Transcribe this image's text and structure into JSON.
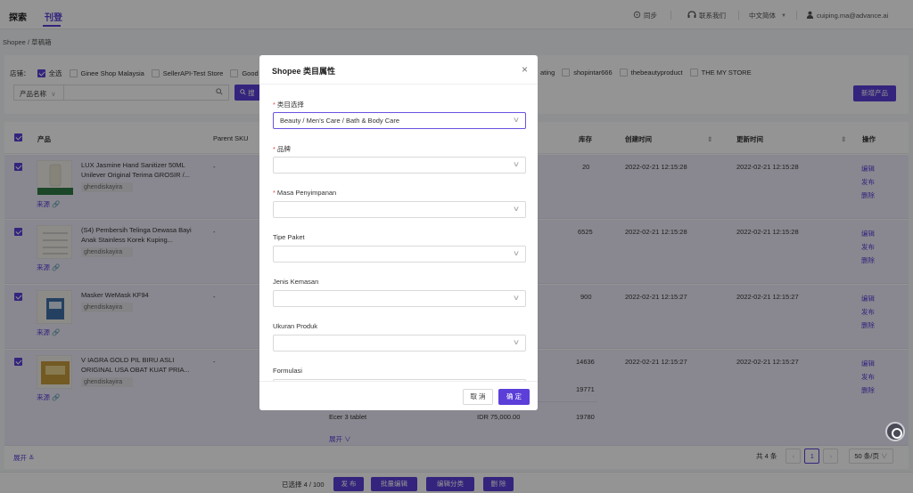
{
  "topbar": {
    "logo": "探索",
    "active_tab": "刊登",
    "sync_label": "同步",
    "contact_label": "联系我们",
    "language_label": "中文简体",
    "user_email": "cuiping.ma@advance.ai"
  },
  "breadcrumb": "Shopee / 草稿箱",
  "filters": {
    "store_label": "店铺：",
    "select_all": "全选",
    "stores_left": [
      "Ginee Shop Malaysia",
      "SellerAPI-Test Store",
      "Good qu"
    ],
    "stores_right": [
      "ating",
      "shopintar666",
      "thebeautyproduct",
      "THE MY STORE"
    ],
    "search_field_label": "产品名称",
    "search_button": "搜",
    "new_product_button": "新增产品"
  },
  "table": {
    "headers": {
      "product": "产品",
      "parent_sku": "Parent SKU",
      "stock": "库存",
      "created": "创建时间",
      "updated": "更新时间",
      "actions": "操作"
    },
    "source_label": "来源",
    "ops": [
      "编辑",
      "发布",
      "删除"
    ],
    "rows": [
      {
        "title": "LUX Jasmine Hand Sanitizer 50ML Unilever Original Terima GROSIR /...",
        "tag": "ghendiskayira",
        "sku": "-",
        "stock": "20",
        "created": "2022-02-21 12:15:28",
        "updated": "2022-02-21 12:15:28"
      },
      {
        "title": "(S4) Pembersih Telinga Dewasa Bayi Anak Stainless Korek Kuping...",
        "tag": "ghendiskayira",
        "sku": "-",
        "stock": "6525",
        "created": "2022-02-21 12:15:28",
        "updated": "2022-02-21 12:15:28"
      },
      {
        "title": "Masker WeMask KF94",
        "tag": "ghendiskayira",
        "sku": "-",
        "stock": "900",
        "created": "2022-02-21 12:15:27",
        "updated": "2022-02-21 12:15:27"
      },
      {
        "title": "V IAGRA GOLD PIL BIRU ASLI ORIGINAL USA OBAT KUAT PRIA...",
        "tag": "ghendiskayira",
        "sku": "-",
        "stock": "14636",
        "created": "2022-02-21 12:15:27",
        "updated": "2022-02-21 12:15:27"
      }
    ],
    "variant_rows": [
      {
        "name": "",
        "price": "",
        "stock": "19771"
      },
      {
        "name": "Ecer 3 tablet",
        "price": "IDR 75,000.00",
        "stock": "19780"
      }
    ],
    "variant_expand": "展开"
  },
  "list_footer": {
    "expand": "展开",
    "total": "共 4 条",
    "current_page": "1",
    "page_size": "50 条/页"
  },
  "bulk_bar": {
    "selected": "已选择 4 / 100",
    "publish": "发 布",
    "bulk_edit": "批量编辑",
    "edit_category": "编辑分类",
    "delete": "删 除"
  },
  "modal": {
    "title": "Shopee 类目属性",
    "fields": [
      {
        "label": "类目选择",
        "required": true,
        "value": "Beauty / Men's Care / Bath & Body Care"
      },
      {
        "label": "品牌",
        "required": true,
        "value": ""
      },
      {
        "label": "Masa Penyimpanan",
        "required": true,
        "value": ""
      },
      {
        "label": "Tipe Paket",
        "required": false,
        "value": ""
      },
      {
        "label": "Jenis Kemasan",
        "required": false,
        "value": ""
      },
      {
        "label": "Ukuran Produk",
        "required": false,
        "value": ""
      },
      {
        "label": "Formulasi",
        "required": false,
        "value": ""
      }
    ],
    "cancel": "取 消",
    "confirm": "确 定"
  },
  "colors": {
    "accent": "#5b3fd8",
    "required": "#e54545"
  }
}
